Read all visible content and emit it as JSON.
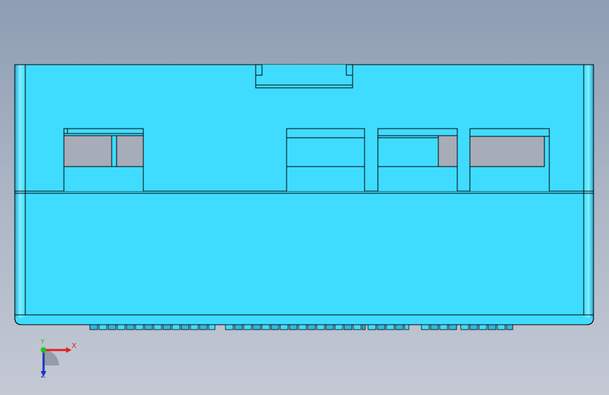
{
  "view": {
    "background_top": "#8d9db2",
    "background_bottom": "#c4c9d4",
    "part_color": "#3fdcff",
    "edge_color": "#000000",
    "shade_color": "#2fb8e0"
  },
  "triad": {
    "x_label": "X",
    "y_label": "Y",
    "z_label": "Z",
    "x_color": "#e02020",
    "y_color": "#20c020",
    "z_color": "#2030c0"
  }
}
